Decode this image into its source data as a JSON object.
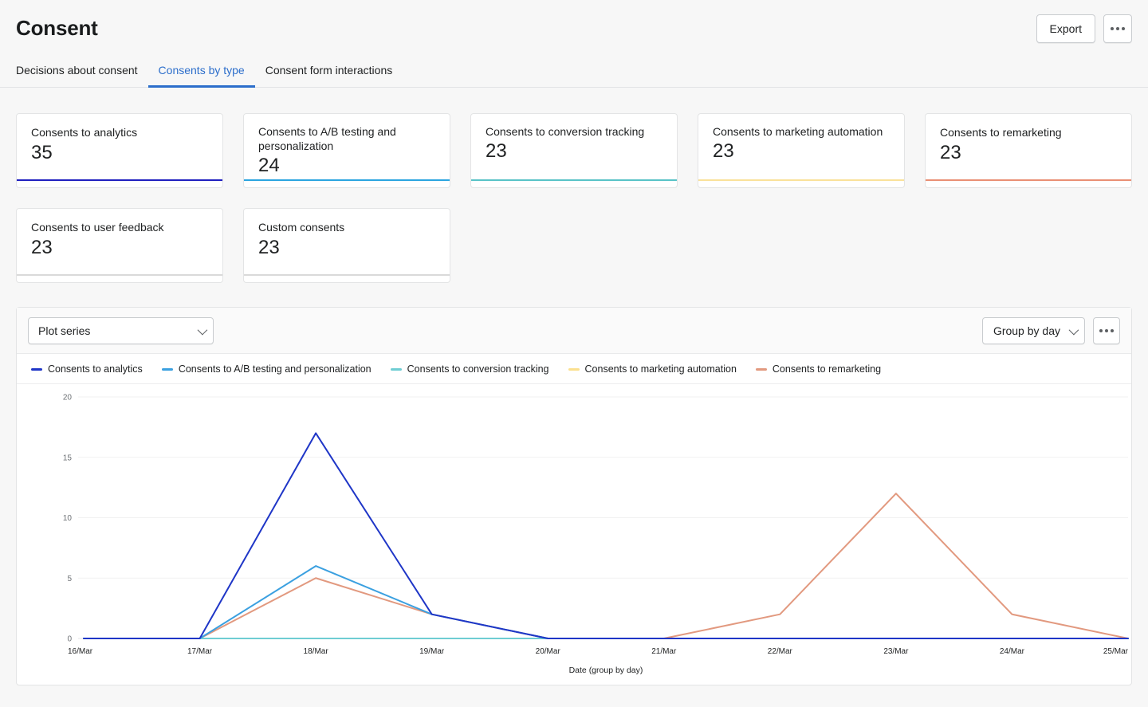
{
  "header": {
    "title": "Consent",
    "export_label": "Export",
    "more_label": "More actions"
  },
  "tabs": [
    {
      "label": "Decisions about consent",
      "active": false
    },
    {
      "label": "Consents by type",
      "active": true
    },
    {
      "label": "Consent form interactions",
      "active": false
    }
  ],
  "cards": [
    {
      "label": "Consents to analytics",
      "value": "35",
      "color": "#2020bf",
      "two_line": false
    },
    {
      "label": "Consents to A/B testing and personalization",
      "value": "24",
      "color": "#2ca5e0",
      "two_line": true
    },
    {
      "label": "Consents to conversion tracking",
      "value": "23",
      "color": "#59c3c7",
      "two_line": true
    },
    {
      "label": "Consents to marketing automation",
      "value": "23",
      "color": "#fae29a",
      "two_line": true
    },
    {
      "label": "Consents to remarketing",
      "value": "23",
      "color": "#e98f74",
      "two_line": false
    },
    {
      "label": "Consents to user feedback",
      "value": "23",
      "color": "#d9d9d9",
      "two_line": false
    },
    {
      "label": "Custom consents",
      "value": "23",
      "color": "#d9d9d9",
      "two_line": false
    }
  ],
  "chart_toolbar": {
    "plot_series_label": "Plot series",
    "group_by_label": "Group by day",
    "more_label": "More actions"
  },
  "chart_data": {
    "type": "line",
    "title": "",
    "xlabel": "Date (group by day)",
    "ylabel": "",
    "grid": true,
    "legend_position": "top",
    "ylim": [
      0,
      20
    ],
    "yticks": [
      0,
      5,
      10,
      15,
      20
    ],
    "categories": [
      "16/Mar",
      "17/Mar",
      "18/Mar",
      "19/Mar",
      "20/Mar",
      "21/Mar",
      "22/Mar",
      "23/Mar",
      "24/Mar",
      "25/Mar"
    ],
    "series": [
      {
        "name": "Consents to analytics",
        "color": "#1f36c7",
        "values": [
          0,
          0,
          17,
          2,
          0,
          0,
          0,
          0,
          0,
          0
        ]
      },
      {
        "name": "Consents to A/B testing and personalization",
        "color": "#3ba0e0",
        "values": [
          0,
          0,
          6,
          2,
          0,
          0,
          0,
          0,
          0,
          0
        ]
      },
      {
        "name": "Consents to conversion tracking",
        "color": "#6fcdd3",
        "values": [
          0,
          0,
          0,
          0,
          0,
          0,
          0,
          0,
          0,
          0
        ]
      },
      {
        "name": "Consents to marketing automation",
        "color": "#fbe08e",
        "values": [
          0,
          0,
          0,
          0,
          0,
          0,
          0,
          0,
          0,
          0
        ]
      },
      {
        "name": "Consents to remarketing",
        "color": "#e2997f",
        "values": [
          0,
          0,
          5,
          2,
          0,
          0,
          2,
          12,
          2,
          0
        ]
      }
    ]
  }
}
